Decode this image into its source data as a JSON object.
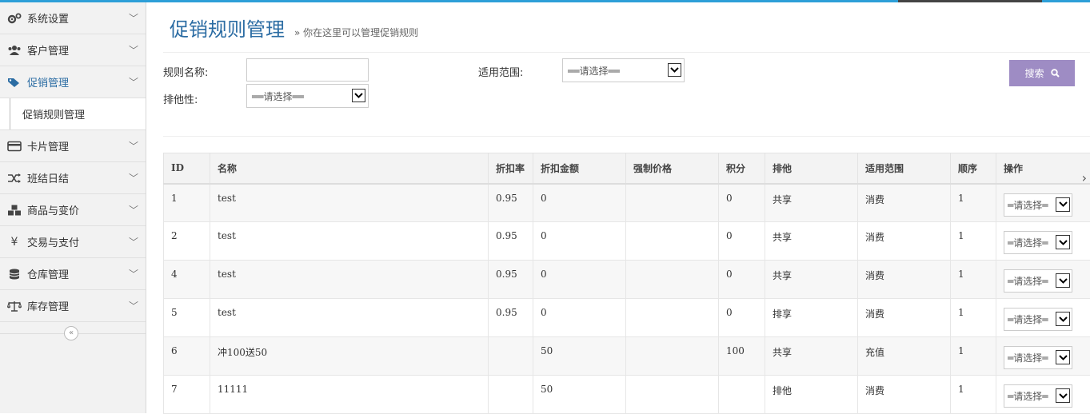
{
  "sidebar": {
    "items": [
      {
        "label": "系统设置",
        "icon": "gears-icon"
      },
      {
        "label": "客户管理",
        "icon": "users-icon"
      },
      {
        "label": "促销管理",
        "icon": "tags-icon"
      },
      {
        "label": "卡片管理",
        "icon": "credit-card-icon"
      },
      {
        "label": "班结日结",
        "icon": "shuffle-icon"
      },
      {
        "label": "商品与变价",
        "icon": "cubes-icon"
      },
      {
        "label": "交易与支付",
        "icon": "yen-icon"
      },
      {
        "label": "仓库管理",
        "icon": "database-icon"
      },
      {
        "label": "库存管理",
        "icon": "balance-scale-icon"
      }
    ],
    "active_sub": "促销规则管理",
    "collapse_glyph": "«"
  },
  "header": {
    "title": "促销规则管理",
    "subtitle": "» 你在这里可以管理促销规则"
  },
  "filters": {
    "rule_name_label": "规则名称:",
    "rule_name_value": "",
    "scope_label": "适用范围:",
    "scope_selected": "══请选择══",
    "exclusive_label": "排他性:",
    "exclusive_selected": "══请选择══",
    "search_label": "搜索"
  },
  "table": {
    "headers": [
      "ID",
      "名称",
      "折扣率",
      "折扣金额",
      "强制价格",
      "积分",
      "排他",
      "适用范围",
      "顺序",
      "操作"
    ],
    "rows": [
      {
        "id": "1",
        "name": "test",
        "rate": "0.95",
        "amount": "0",
        "forced": "",
        "points": "0",
        "exclusive": "共享",
        "scope": "消费",
        "order": "1",
        "action": "═请选择═"
      },
      {
        "id": "2",
        "name": "test",
        "rate": "0.95",
        "amount": "0",
        "forced": "",
        "points": "0",
        "exclusive": "共享",
        "scope": "消费",
        "order": "1",
        "action": "═请选择═"
      },
      {
        "id": "4",
        "name": "test",
        "rate": "0.95",
        "amount": "0",
        "forced": "",
        "points": "0",
        "exclusive": "共享",
        "scope": "消费",
        "order": "1",
        "action": "═请选择═"
      },
      {
        "id": "5",
        "name": "test",
        "rate": "0.95",
        "amount": "0",
        "forced": "",
        "points": "0",
        "exclusive": "排享",
        "scope": "消费",
        "order": "1",
        "action": "═请选择═"
      },
      {
        "id": "6",
        "name": "冲100送50",
        "rate": "",
        "amount": "50",
        "forced": "",
        "points": "100",
        "exclusive": "共享",
        "scope": "充值",
        "order": "1",
        "action": "═请选择═"
      },
      {
        "id": "7",
        "name": "11111",
        "rate": "",
        "amount": "50",
        "forced": "",
        "points": "",
        "exclusive": "排他",
        "scope": "消费",
        "order": "1",
        "action": "═请选择═"
      }
    ]
  },
  "colors": {
    "accent": "#2b6ca3",
    "search_button": "#9e8cc4",
    "top_bar": "#2d9fd8"
  }
}
